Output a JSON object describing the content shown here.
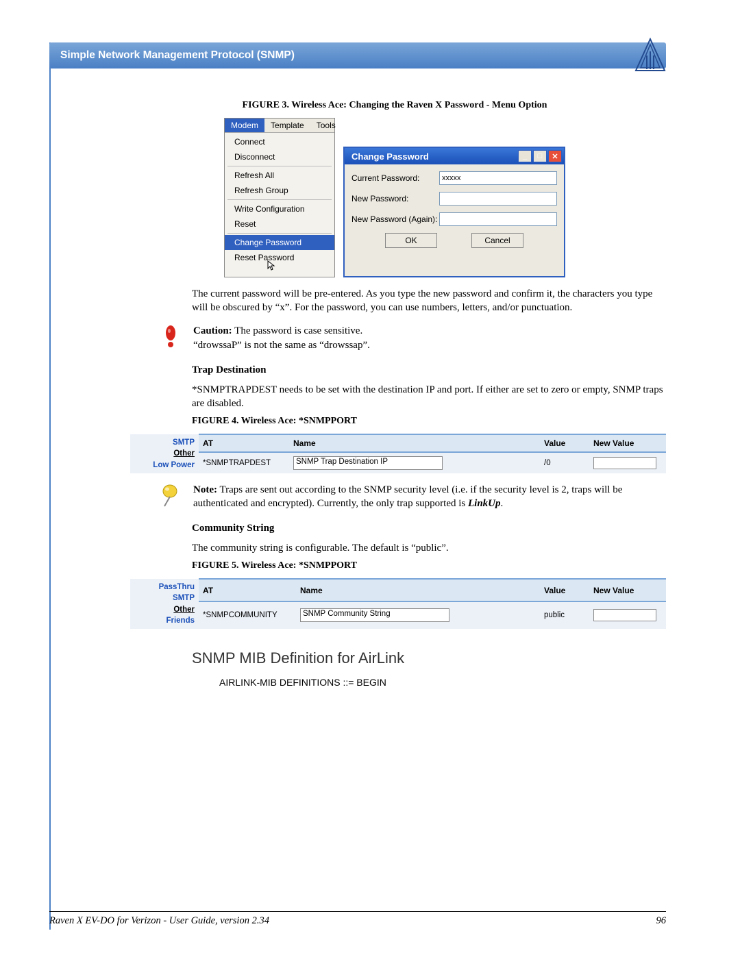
{
  "header": {
    "title": "Simple Network Management Protocol (SNMP)"
  },
  "fig3": {
    "caption_prefix": "FIGURE 3.",
    "caption": " Wireless Ace: Changing the Raven X Password - Menu Option",
    "menubar": [
      "Modem",
      "Template",
      "Tools"
    ],
    "menu_items": [
      [
        "Connect",
        "Disconnect"
      ],
      [
        "Refresh All",
        "Refresh Group"
      ],
      [
        "Write Configuration",
        "Reset"
      ],
      [
        "Change Password",
        "Reset Password"
      ]
    ],
    "highlight": "Change Password",
    "dialog": {
      "title": "Change Password",
      "current_label": "Current Password:",
      "current_value": "xxxxx",
      "new_label": "New Password:",
      "again_label": "New Password (Again):",
      "ok": "OK",
      "cancel": "Cancel"
    }
  },
  "para1": "The current password will be pre-entered.  As you type the new password and confirm it, the characters you type will be obscured by “x”. For the password, you can use numbers, letters, and/or punctuation.",
  "caution": {
    "label": "Caution:",
    "l1": " The password is case sensitive.",
    "l2": "“drowssaP” is not the same as “drowssap”."
  },
  "trap": {
    "heading": "Trap Destination",
    "para": "*SNMPTRAPDEST needs to be set with the destination IP and port.  If either are set to zero or empty, SNMP traps are disabled."
  },
  "fig4": {
    "caption_prefix": "FIGURE 4.",
    "caption": " Wireless Ace: *SNMPPORT",
    "side": [
      "SMTP",
      "Other",
      "Low Power"
    ],
    "cols": [
      "AT",
      "Name",
      "Value",
      "New Value"
    ],
    "row": {
      "at": "*SNMPTRAPDEST",
      "name": "SNMP Trap Destination IP",
      "value": "/0",
      "newv": ""
    }
  },
  "note": {
    "label": "Note:",
    "text_a": " Traps are sent out according to the SNMP security level (i.e. if the security level is 2, traps will be authenticated and encrypted). Currently, the only trap supported is ",
    "italic": "LinkUp",
    "text_b": "."
  },
  "comm": {
    "heading": "Community String",
    "para": "The community string is configurable.  The default is “public”."
  },
  "fig5": {
    "caption_prefix": "FIGURE 5.",
    "caption": " Wireless Ace: *SNMPPORT",
    "side": [
      "PassThru",
      "SMTP",
      "Other",
      "Friends"
    ],
    "cols": [
      "AT",
      "Name",
      "Value",
      "New Value"
    ],
    "row": {
      "at": "*SNMPCOMMUNITY",
      "name": "SNMP Community String",
      "value": "public",
      "newv": ""
    }
  },
  "bigheading": "SNMP MIB Definition for AirLink",
  "mibline": "AIRLINK-MIB DEFINITIONS ::= BEGIN",
  "footer": {
    "left": "Raven X EV-DO for Verizon - User Guide, version 2.34",
    "right": "96"
  }
}
